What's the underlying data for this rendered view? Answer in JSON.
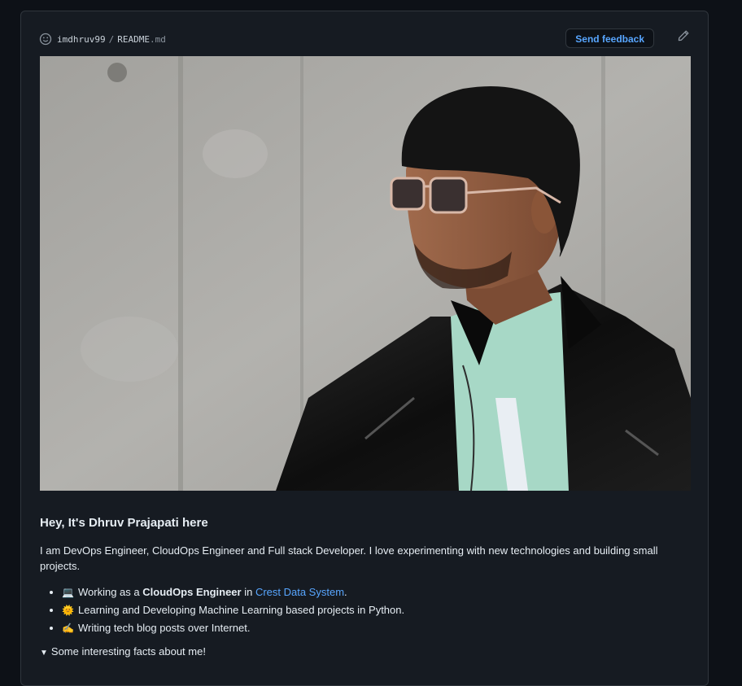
{
  "header": {
    "owner": "imdhruv99",
    "separator": "/",
    "file_name": "README",
    "file_ext": ".md",
    "feedback_label": "Send feedback"
  },
  "readme": {
    "heading": "Hey, It's Dhruv Prajapati here",
    "intro": "I am DevOps Engineer, CloudOps Engineer and Full stack Developer. I love experimenting with new technologies and building small projects.",
    "items": [
      {
        "emoji": "💻",
        "prefix": "Working as a ",
        "bold": "CloudOps Engineer",
        "middle": " in ",
        "link": "Crest Data System",
        "suffix": "."
      },
      {
        "emoji": "🌞",
        "text": "Learning and Developing Machine Learning based projects in Python."
      },
      {
        "emoji": "✍️",
        "text": "Writing tech blog posts over Internet."
      }
    ],
    "details_summary": "Some interesting facts about me!"
  },
  "icons": {
    "smiley": "smiley-icon",
    "pencil": "pencil-icon",
    "triangle": "triangle-down-icon"
  },
  "colors": {
    "link": "#58a6ff",
    "background": "#0d1117",
    "card": "#161b22"
  }
}
